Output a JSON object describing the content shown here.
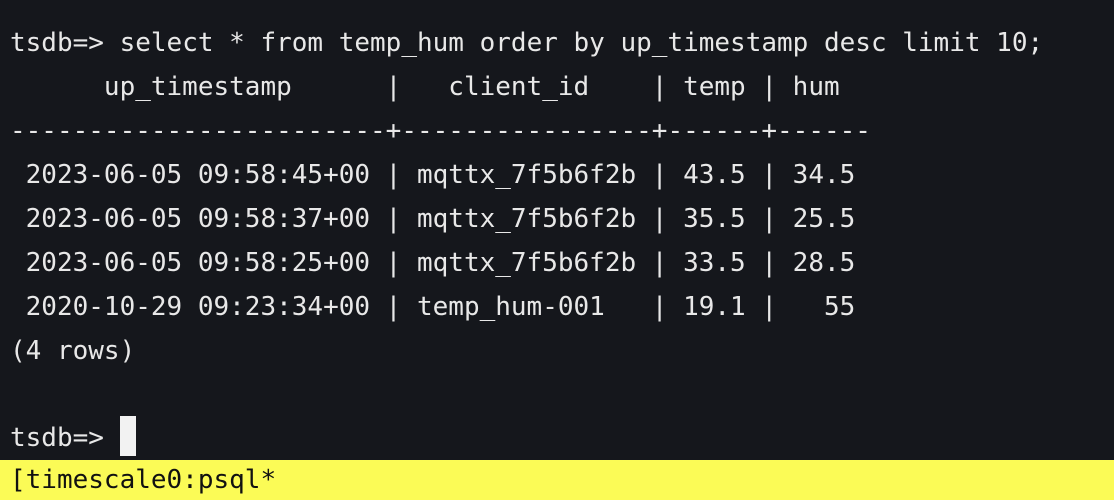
{
  "terminal": {
    "prompt": "tsdb=> ",
    "command": "select * from temp_hum order by up_timestamp desc limit 10;",
    "header_line": "      up_timestamp      |   client_id    | temp | hum",
    "separator_line": "------------------------+----------------+------+------",
    "rows": [
      " 2023-06-05 09:58:45+00 | mqttx_7f5b6f2b | 43.5 | 34.5",
      " 2023-06-05 09:58:37+00 | mqttx_7f5b6f2b | 35.5 | 25.5",
      " 2023-06-05 09:58:25+00 | mqttx_7f5b6f2b | 33.5 | 28.5",
      " 2020-10-29 09:23:34+00 | temp_hum-001   | 19.1 |   55"
    ],
    "row_count_text": "(4 rows)",
    "final_prompt": "tsdb=> "
  },
  "status_bar": {
    "text": "[timescale0:psql*"
  },
  "colors": {
    "background": "#15171c",
    "foreground": "#e8e8e8",
    "status_bar_bg": "#fbfb56"
  }
}
